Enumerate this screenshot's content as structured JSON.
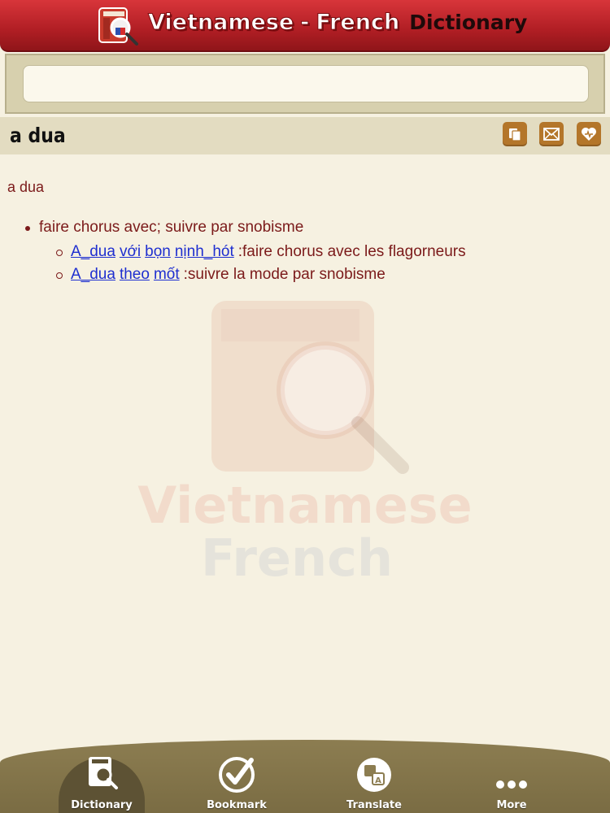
{
  "header": {
    "title_main": "Vietnamese",
    "title_sep": "-",
    "title_second": "French",
    "title_sub": "Dictionary",
    "logo_icon": "dictionary-book-magnifier-icon"
  },
  "search": {
    "value": "",
    "placeholder": ""
  },
  "word_bar": {
    "word": "a dua",
    "actions": [
      {
        "name": "copy-button",
        "icon": "copy-icon"
      },
      {
        "name": "email-button",
        "icon": "mail-icon"
      },
      {
        "name": "favorite-button",
        "icon": "heart-icon"
      }
    ]
  },
  "entry": {
    "word": "a dua",
    "definitions": [
      {
        "meaning": "faire chorus avec; suivre par snobisme",
        "examples": [
          {
            "words": [
              "A_dua",
              "với",
              "bọn",
              "nịnh_hót"
            ],
            "translation": ":faire chorus avec les flagorneurs"
          },
          {
            "words": [
              "A_dua",
              "theo",
              "mốt"
            ],
            "translation": ":suivre la mode par snobisme"
          }
        ]
      }
    ]
  },
  "watermark": {
    "line1": "Vietnamese",
    "line2": "French"
  },
  "tabbar": {
    "tabs": [
      {
        "label": "Dictionary",
        "icon": "dictionary-icon",
        "active": true
      },
      {
        "label": "Bookmark",
        "icon": "checkmark-icon",
        "active": false
      },
      {
        "label": "Translate",
        "icon": "translate-icon",
        "active": false
      },
      {
        "label": "More",
        "icon": "more-dots-icon",
        "active": false
      }
    ]
  },
  "colors": {
    "header_red": "#c0272d",
    "background": "#f6f1e1",
    "link_blue": "#1f2fd0",
    "text_maroon": "#7b1a1a",
    "tabbar_brown": "#8c7d51",
    "action_button": "#b4762a"
  }
}
